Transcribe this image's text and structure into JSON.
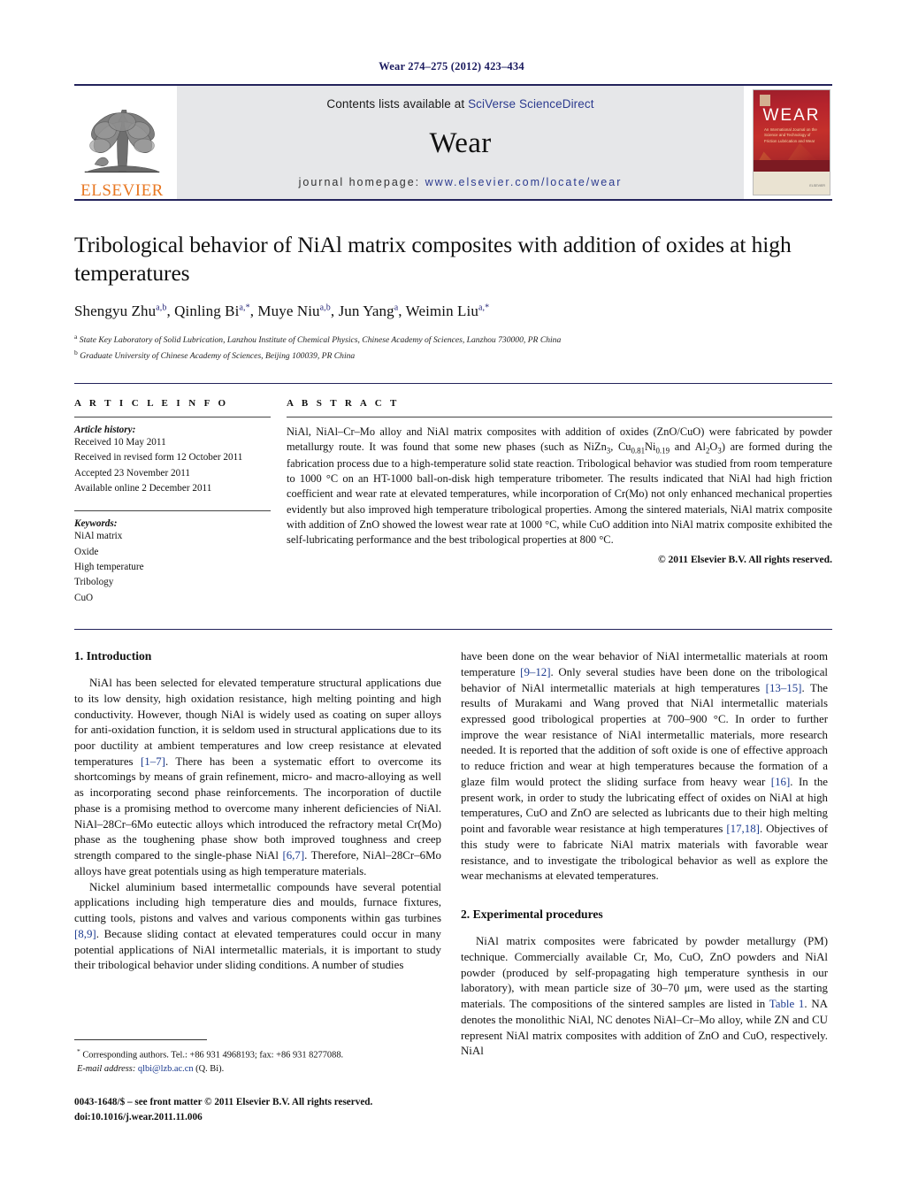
{
  "running_head": "Wear 274–275 (2012) 423–434",
  "masthead": {
    "contents_prefix": "Contents lists available at ",
    "sciencedirect": "SciVerse ScienceDirect",
    "journal_name": "Wear",
    "homepage_prefix": "journal homepage: ",
    "homepage_url": "www.elsevier.com/locate/wear",
    "publisher_wordmark": "ELSEVIER",
    "cover": {
      "title": "WEAR",
      "subtitle": "An International Journal on the Science and Technology of Friction Lubrication and Wear",
      "footer": "ELSEVIER"
    },
    "colors": {
      "rule": "#23235b",
      "panel_bg": "#e6e7e9",
      "link": "#2c3b8f",
      "elsevier_orange": "#E87722",
      "cover_red": "#b5232c"
    }
  },
  "article": {
    "title": "Tribological behavior of NiAl matrix composites with addition of oxides at high temperatures",
    "authors_html": "Shengyu Zhu<sup>a,b</sup>, Qinling Bi<sup>a,*</sup>, Muye Niu<sup>a,b</sup>, Jun Yang<sup>a</sup>, Weimin Liu<sup>a,*</sup>",
    "affiliations": [
      "State Key Laboratory of Solid Lubrication, Lanzhou Institute of Chemical Physics, Chinese Academy of Sciences, Lanzhou 730000, PR China",
      "Graduate University of Chinese Academy of Sciences, Beijing 100039, PR China"
    ],
    "affiliation_marks": [
      "a",
      "b"
    ]
  },
  "article_info": {
    "label": "A R T I C L E    I N F O",
    "history_heading": "Article history:",
    "history": [
      "Received 10 May 2011",
      "Received in revised form 12 October 2011",
      "Accepted 23 November 2011",
      "Available online 2 December 2011"
    ],
    "keywords_heading": "Keywords:",
    "keywords": [
      "NiAl matrix",
      "Oxide",
      "High temperature",
      "Tribology",
      "CuO"
    ]
  },
  "abstract": {
    "label": "A B S T R A C T",
    "text_html": "NiAl, NiAl–Cr–Mo alloy and NiAl matrix composites with addition of oxides (ZnO/CuO) were fabricated by powder metallurgy route. It was found that some new phases (such as NiZn<sub>3</sub>, Cu<sub>0.81</sub>Ni<sub>0.19</sub> and Al<sub>2</sub>O<sub>3</sub>) are formed during the fabrication process due to a high-temperature solid state reaction. Tribological behavior was studied from room temperature to 1000 &deg;C on an HT-1000 ball-on-disk high temperature tribometer. The results indicated that NiAl had high friction coefficient and wear rate at elevated temperatures, while incorporation of Cr(Mo) not only enhanced mechanical properties evidently but also improved high temperature tribological properties. Among the sintered materials, NiAl matrix composite with addition of ZnO showed the lowest wear rate at 1000&nbsp;&deg;C, while CuO addition into NiAl matrix composite exhibited the self-lubricating performance and the best tribological properties at 800&nbsp;&deg;C.",
    "copyright": "© 2011 Elsevier B.V. All rights reserved."
  },
  "sections": {
    "introduction": {
      "number_title": "1.  Introduction",
      "paragraphs_left": [
        "NiAl has been selected for elevated temperature structural applications due to its low density, high oxidation resistance, high melting pointing and high conductivity. However, though NiAl is widely used as coating on super alloys for anti-oxidation function, it is seldom used in structural applications due to its poor ductility at ambient temperatures and low creep resistance at elevated temperatures <cite>[1–7]</cite>. There has been a systematic effort to overcome its shortcomings by means of grain refinement, micro- and macro-alloying as well as incorporating second phase reinforcements. The incorporation of ductile phase is a promising method to overcome many inherent deficiencies of NiAl. NiAl–28Cr–6Mo eutectic alloys which introduced the refractory metal Cr(Mo) phase as the toughening phase show both improved toughness and creep strength compared to the single-phase NiAl <cite>[6,7]</cite>. Therefore, NiAl–28Cr–6Mo alloys have great potentials using as high temperature materials.",
        "Nickel aluminium based intermetallic compounds have several potential applications including high temperature dies and moulds, furnace fixtures, cutting tools, pistons and valves and various components within gas turbines <cite>[8,9]</cite>. Because sliding contact at elevated temperatures could occur in many potential applications of NiAl intermetallic materials, it is important to study their tribological behavior under sliding conditions. A number of studies"
      ],
      "paragraphs_right": [
        "have been done on the wear behavior of NiAl intermetallic materials at room temperature <cite>[9–12]</cite>. Only several studies have been done on the tribological behavior of NiAl intermetallic materials at high temperatures <cite>[13–15]</cite>. The results of Murakami and Wang proved that NiAl intermetallic materials expressed good tribological properties at 700–900 &deg;C. In order to further improve the wear resistance of NiAl intermetallic materials, more research needed. It is reported that the addition of soft oxide is one of effective approach to reduce friction and wear at high temperatures because the formation of a glaze film would protect the sliding surface from heavy wear <cite>[16]</cite>. In the present work, in order to study the lubricating effect of oxides on NiAl at high temperatures, CuO and ZnO are selected as lubricants due to their high melting point and favorable wear resistance at high temperatures <cite>[17,18]</cite>. Objectives of this study were to fabricate NiAl matrix materials with favorable wear resistance, and to investigate the tribological behavior as well as explore the wear mechanisms at elevated temperatures."
      ]
    },
    "experimental": {
      "number_title": "2.  Experimental procedures",
      "paragraphs": [
        "NiAl matrix composites were fabricated by powder metallurgy (PM) technique. Commercially available Cr, Mo, CuO, ZnO powders and NiAl powder (produced by self-propagating high temperature synthesis in our laboratory), with mean particle size of 30–70 μm, were used as the starting materials. The compositions of the sintered samples are listed in <cite>Table 1</cite>. NA denotes the monolithic NiAl, NC denotes NiAl–Cr–Mo alloy, while ZN and CU represent NiAl matrix composites with addition of ZnO and CuO, respectively. NiAl"
      ]
    }
  },
  "footnotes": {
    "corresponding_html": "<sup>*</sup> Corresponding authors. Tel.: +86 931 4968193; fax: +86 931 8277088.",
    "email_label": "E-mail address:",
    "email": "qlbi@lzb.ac.cn",
    "email_suffix": " (Q. Bi)."
  },
  "footer": {
    "issn_line": "0043-1648/$ – see front matter © 2011 Elsevier B.V. All rights reserved.",
    "doi_line": "doi:10.1016/j.wear.2011.11.006"
  }
}
